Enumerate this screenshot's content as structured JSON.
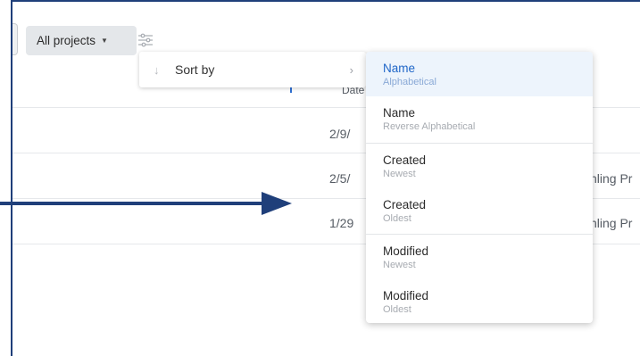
{
  "toolbar": {
    "projects_filter_label": "All projects",
    "projects_caret": "▼"
  },
  "table": {
    "date_header": "Date",
    "rows": [
      {
        "date": "2/9/",
        "name": ""
      },
      {
        "date": "2/5/",
        "name": "chling Pr"
      },
      {
        "date": "1/29",
        "name": "chling Pr"
      }
    ]
  },
  "sort_menu": {
    "label": "Sort by",
    "arrow": "↓",
    "chevron": "›"
  },
  "sort_options": [
    {
      "label": "Name",
      "sublabel": "Alphabetical",
      "selected": true
    },
    {
      "label": "Name",
      "sublabel": "Reverse Alphabetical",
      "selected": false
    },
    {
      "label": "Created",
      "sublabel": "Newest",
      "selected": false
    },
    {
      "label": "Created",
      "sublabel": "Oldest",
      "selected": false
    },
    {
      "label": "Modified",
      "sublabel": "Newest",
      "selected": false
    },
    {
      "label": "Modified",
      "sublabel": "Oldest",
      "selected": false
    }
  ],
  "colors": {
    "frame_border": "#1f3f7a",
    "selected_text": "#1f66c8",
    "selected_bg": "#edf4fc",
    "annotation_arrow": "#1f3f7a"
  },
  "icons": {
    "filter": "sliders-icon",
    "annotation": "arrow-right-icon"
  }
}
